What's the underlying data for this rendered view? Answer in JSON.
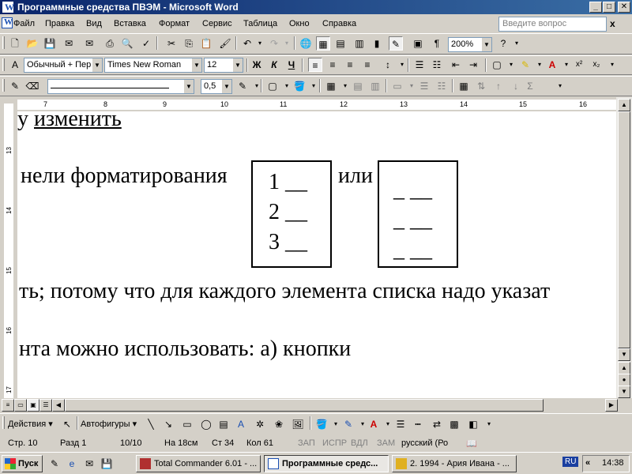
{
  "window": {
    "title": "Программные средства ПВЭМ - Microsoft Word",
    "buttons": {
      "minimize": "_",
      "maximize": "□",
      "close": "✕"
    }
  },
  "menu": {
    "items": [
      {
        "label": "Файл"
      },
      {
        "label": "Правка"
      },
      {
        "label": "Вид"
      },
      {
        "label": "Вставка"
      },
      {
        "label": "Формат"
      },
      {
        "label": "Сервис"
      },
      {
        "label": "Таблица"
      },
      {
        "label": "Окно"
      },
      {
        "label": "Справка"
      }
    ],
    "ask_placeholder": "Введите вопрос",
    "close": "x"
  },
  "standard_toolbar": {
    "zoom": "200%"
  },
  "format_toolbar": {
    "style": "Обычный + Пер",
    "font": "Times New Roman",
    "size": "12",
    "bold": "Ж",
    "italic": "К",
    "underline": "Ч"
  },
  "drawing_props_toolbar": {
    "line_weight": "0,5"
  },
  "ruler": {
    "horizontal": [
      "7",
      "8",
      "9",
      "10",
      "11",
      "12",
      "13",
      "14",
      "15",
      "16"
    ],
    "vertical": [
      "13",
      "14",
      "15",
      "16",
      "17"
    ]
  },
  "document": {
    "line1_prefix": "у",
    "line1_link": "изменить",
    "line2_text": "нели форматирования",
    "line2_or": "или",
    "numbered_box": [
      "1 __",
      "2 __",
      "3 __"
    ],
    "bullet_box": [
      "_ __",
      "_ __",
      "_ __"
    ],
    "line3": "ть; потому что для каждого элемента списка надо указат",
    "line4": "нта можно использовать: а) кнопки"
  },
  "draw_toolbar": {
    "actions": "Действия",
    "autoshapes": "Автофигуры"
  },
  "status": {
    "page": "Стр. 10",
    "section": "Разд 1",
    "pages": "10/10",
    "at": "На 18см",
    "line": "Ст 34",
    "col": "Кол 61",
    "rec": "ЗАП",
    "trk": "ИСПР",
    "ext": "ВДЛ",
    "ovr": "ЗАМ",
    "lang": "русский (Ро"
  },
  "taskbar": {
    "start": "Пуск",
    "tasks": [
      {
        "label": "Total Commander 6.01 - ..."
      },
      {
        "label": "Программные средс..."
      },
      {
        "label": "2. 1994 - Ария Ивана - ..."
      }
    ],
    "lang": "RU",
    "chevron": "«",
    "clock": "14:38"
  }
}
